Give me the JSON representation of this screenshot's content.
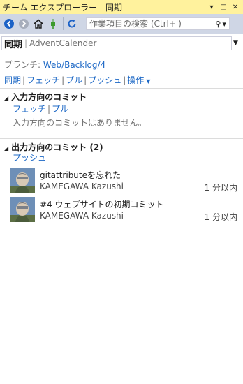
{
  "window": {
    "title": "チーム エクスプローラー - 同期",
    "pin_glyph": "▾",
    "maximize_glyph": "□",
    "close_glyph": "✕"
  },
  "toolbar": {
    "search_placeholder": "作業項目の検索 (Ctrl+')",
    "search_glyph": "⚲",
    "search_dropdown_glyph": "▾"
  },
  "page_header": {
    "title": "同期",
    "divider": "|",
    "context": "AdventCalender",
    "dropdown_glyph": "▼"
  },
  "branch": {
    "label": "ブランチ:",
    "name": "Web/Backlog/4"
  },
  "actions": {
    "items": [
      "同期",
      "フェッチ",
      "プル",
      "プッシュ",
      "操作"
    ],
    "separator": "|",
    "caret": "▼"
  },
  "incoming": {
    "title": "入力方向のコミット",
    "expand_glyph": "◢",
    "links": [
      "フェッチ",
      "プル"
    ],
    "separator": "|",
    "empty_text": "入力方向のコミットはありません。"
  },
  "outgoing": {
    "title": "出力方向のコミット (2)",
    "expand_glyph": "◢",
    "push_label": "プッシュ",
    "commits": [
      {
        "message": "gitattributeを忘れた",
        "author": "KAMEGAWA Kazushi",
        "time": "1 分以内"
      },
      {
        "message": "#4 ウェブサイトの初期コミット",
        "author": "KAMEGAWA Kazushi",
        "time": "1 分以内"
      }
    ]
  },
  "colors": {
    "title_bar": "#fff29d",
    "toolbar": "#cfd6e5",
    "link": "#1e69c6",
    "icon_blue": "#1c62c7",
    "icon_green": "#3c9a2e"
  }
}
